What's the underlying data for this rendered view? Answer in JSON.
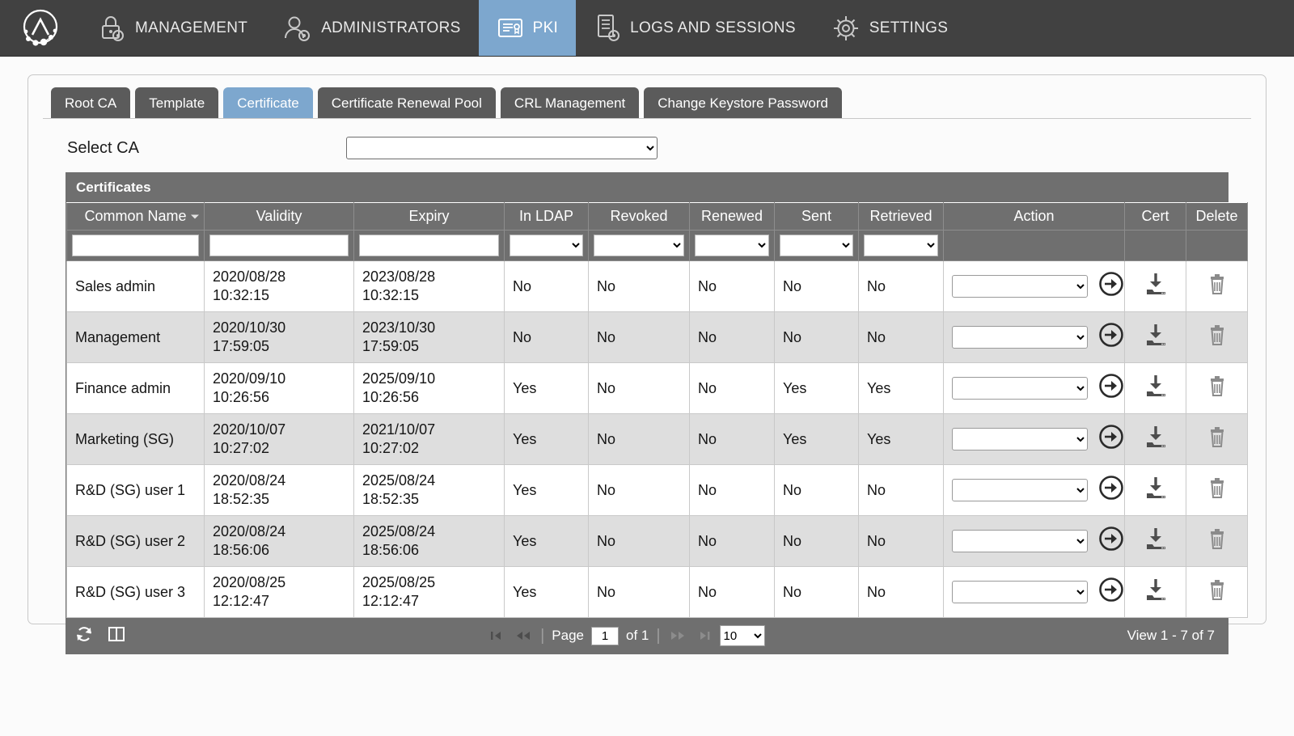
{
  "topnav": {
    "logo_name": "app-logo",
    "items": [
      {
        "label": "MANAGEMENT",
        "icon": "lock-gear-icon",
        "active": false
      },
      {
        "label": "ADMINISTRATORS",
        "icon": "user-gear-icon",
        "active": false
      },
      {
        "label": "PKI",
        "icon": "certificate-icon",
        "active": true
      },
      {
        "label": "LOGS AND SESSIONS",
        "icon": "document-gear-icon",
        "active": false
      },
      {
        "label": "SETTINGS",
        "icon": "gear-icon",
        "active": false
      }
    ],
    "active_color": "#7da7ce",
    "bar_color": "#414141"
  },
  "tabs": [
    {
      "label": "Root CA",
      "active": false
    },
    {
      "label": "Template",
      "active": false
    },
    {
      "label": "Certificate",
      "active": true
    },
    {
      "label": "Certificate Renewal Pool",
      "active": false
    },
    {
      "label": "CRL Management",
      "active": false
    },
    {
      "label": "Change Keystore Password",
      "active": false
    }
  ],
  "select_ca": {
    "label": "Select CA",
    "value": "",
    "options": [
      ""
    ]
  },
  "grid": {
    "title": "Certificates",
    "sort_column": "Common Name",
    "sort_direction": "asc",
    "columns": [
      "Common Name",
      "Validity",
      "Expiry",
      "In LDAP",
      "Revoked",
      "Renewed",
      "Sent",
      "Retrieved",
      "Action",
      "Cert",
      "Delete"
    ],
    "filters": {
      "common_name": "",
      "validity": "",
      "expiry": "",
      "in_ldap": "",
      "revoked": "",
      "renewed": "",
      "sent": "",
      "retrieved": ""
    },
    "filter_placeholders": {
      "common_name": "",
      "validity": "",
      "expiry": ""
    },
    "rows": [
      {
        "common_name": "Sales admin",
        "validity_date": "2020/08/28",
        "validity_time": "10:32:15",
        "expiry_date": "2023/08/28",
        "expiry_time": "10:32:15",
        "in_ldap": "No",
        "revoked": "No",
        "renewed": "No",
        "sent": "No",
        "retrieved": "No",
        "action_value": "",
        "cert_icon": "download-icon",
        "delete_icon": "trash-icon"
      },
      {
        "common_name": "Management",
        "validity_date": "2020/10/30",
        "validity_time": "17:59:05",
        "expiry_date": "2023/10/30",
        "expiry_time": "17:59:05",
        "in_ldap": "No",
        "revoked": "No",
        "renewed": "No",
        "sent": "No",
        "retrieved": "No",
        "action_value": "",
        "cert_icon": "download-icon",
        "delete_icon": "trash-icon"
      },
      {
        "common_name": "Finance admin",
        "validity_date": "2020/09/10",
        "validity_time": "10:26:56",
        "expiry_date": "2025/09/10",
        "expiry_time": "10:26:56",
        "in_ldap": "Yes",
        "revoked": "No",
        "renewed": "No",
        "sent": "Yes",
        "retrieved": "Yes",
        "action_value": "",
        "cert_icon": "download-icon",
        "delete_icon": "trash-icon"
      },
      {
        "common_name": "Marketing (SG)",
        "validity_date": "2020/10/07",
        "validity_time": "10:27:02",
        "expiry_date": "2021/10/07",
        "expiry_time": "10:27:02",
        "in_ldap": "Yes",
        "revoked": "No",
        "renewed": "No",
        "sent": "Yes",
        "retrieved": "Yes",
        "action_value": "",
        "cert_icon": "download-icon",
        "delete_icon": "trash-icon"
      },
      {
        "common_name": "R&D (SG) user 1",
        "validity_date": "2020/08/24",
        "validity_time": "18:52:35",
        "expiry_date": "2025/08/24",
        "expiry_time": "18:52:35",
        "in_ldap": "Yes",
        "revoked": "No",
        "renewed": "No",
        "sent": "No",
        "retrieved": "No",
        "action_value": "",
        "cert_icon": "download-icon",
        "delete_icon": "trash-icon"
      },
      {
        "common_name": "R&D (SG) user 2",
        "validity_date": "2020/08/24",
        "validity_time": "18:56:06",
        "expiry_date": "2025/08/24",
        "expiry_time": "18:56:06",
        "in_ldap": "Yes",
        "revoked": "No",
        "renewed": "No",
        "sent": "No",
        "retrieved": "No",
        "action_value": "",
        "cert_icon": "download-icon",
        "delete_icon": "trash-icon"
      },
      {
        "common_name": "R&D (SG) user 3",
        "validity_date": "2020/08/25",
        "validity_time": "12:12:47",
        "expiry_date": "2025/08/25",
        "expiry_time": "12:12:47",
        "in_ldap": "Yes",
        "revoked": "No",
        "renewed": "No",
        "sent": "No",
        "retrieved": "No",
        "action_value": "",
        "cert_icon": "download-icon",
        "delete_icon": "trash-icon"
      }
    ]
  },
  "footer": {
    "refresh_icon": "refresh-icon",
    "columns_icon": "columns-icon",
    "first_icon": "first-page-icon",
    "prev_icon": "previous-page-icon",
    "next_icon": "next-page-icon",
    "last_icon": "last-page-icon",
    "page_label": "Page",
    "page_value": "1",
    "of_label": "of 1",
    "page_size": "10",
    "page_size_options": [
      "10"
    ],
    "view_status": "View 1 - 7 of 7",
    "bar_color": "#6f6f6f"
  }
}
